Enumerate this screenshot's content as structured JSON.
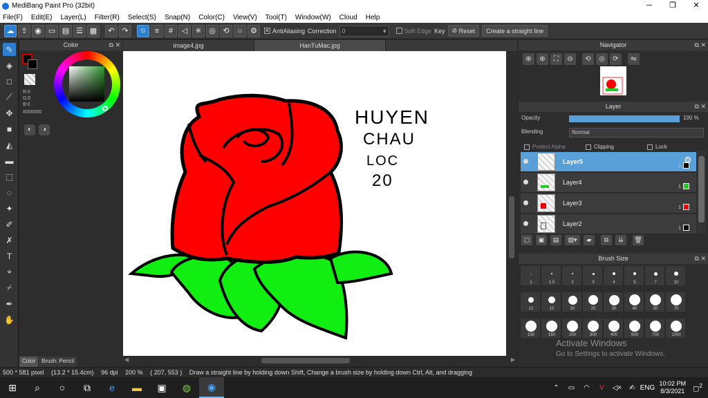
{
  "window": {
    "title": "MediBang Paint Pro (32bit)",
    "minimize": "─",
    "maximize": "❐",
    "close": "✕"
  },
  "menu": [
    "File(F)",
    "Edit(E)",
    "Layer(L)",
    "Filter(R)",
    "Select(S)",
    "Snap(N)",
    "Color(C)",
    "View(V)",
    "Tool(T)",
    "Window(W)",
    "Cloud",
    "Help"
  ],
  "toolbar": {
    "antialiasing_label": "AntiAliasing",
    "antialiasing_checked": "✕",
    "correction_label": "Correction",
    "correction_value": "0",
    "soft_edge_label": "Soft Edge",
    "key_label": "Key",
    "reset_label": "Reset",
    "straight_line_label": "Create a straight line"
  },
  "color_panel": {
    "title": "Color",
    "r": "R:0",
    "g": "G:0",
    "b": "B:0",
    "hex": "#000000",
    "fg_color": "#000000",
    "accent": "#cc0000",
    "tab_color": "Color",
    "tab_brush": "Brush: Pencil"
  },
  "doc_tabs": [
    "image4.jpg",
    "HanTuMac.jpg"
  ],
  "canvas": {
    "handwriting": [
      "HUYEN",
      "CHAU",
      "LOC",
      "20"
    ]
  },
  "navigator": {
    "title": "Navigator"
  },
  "layer_panel": {
    "title": "Layer",
    "opacity_label": "Opacity",
    "opacity_value": "100 %",
    "opacity": 1.0,
    "blending_label": "Blending",
    "blending_value": "Normal",
    "protect_alpha": "Protect Alpha",
    "clipping": "Clipping",
    "lock": "Lock",
    "layers": [
      {
        "name": "Layer5",
        "num": "1",
        "color": "#000000",
        "selected": true
      },
      {
        "name": "Layer4",
        "num": "1",
        "color": "#22cc22",
        "selected": false
      },
      {
        "name": "Layer3",
        "num": "1",
        "color": "#ee0000",
        "selected": false
      },
      {
        "name": "Layer2",
        "num": "1",
        "color": "#000000",
        "selected": false
      }
    ]
  },
  "brush_size": {
    "title": "Brush Size",
    "sizes": [
      "1",
      "1.5",
      "2",
      "3",
      "4",
      "5",
      "7",
      "10",
      "12",
      "15",
      "20",
      "25",
      "30",
      "40",
      "50",
      "70",
      "100",
      "150",
      "200",
      "300",
      "400",
      "500",
      "700",
      "1000"
    ]
  },
  "watermark": {
    "line1": "Activate Windows",
    "line2": "Go to Settings to activate Windows."
  },
  "status": {
    "size": "500 * 581 pixel",
    "cm": "(13.2 * 15.4cm)",
    "dpi": "96 dpi",
    "zoom": "200 %",
    "coords": "( 207, 553 )",
    "hint": "Draw a straight line by holding down Shift, Change a brush size by holding down Ctrl, Alt, and dragging"
  },
  "taskbar": {
    "lang": "ENG",
    "time": "10:02 PM",
    "date": "8/3/2021",
    "notif": "2"
  }
}
